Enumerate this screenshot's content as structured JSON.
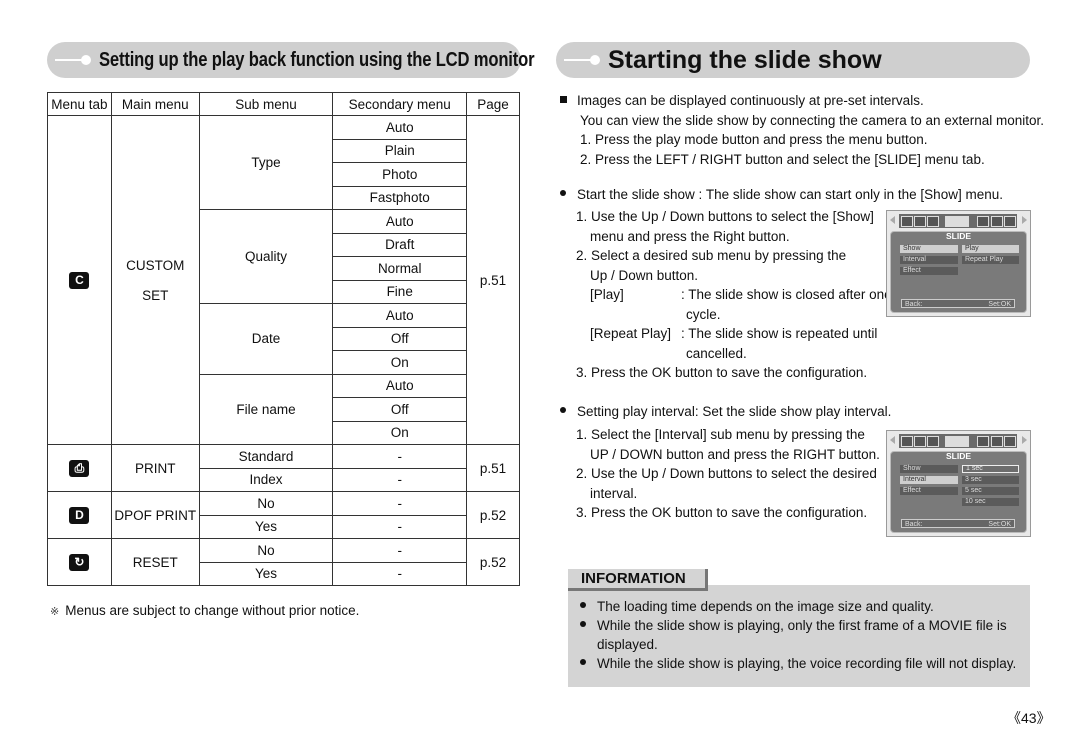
{
  "left": {
    "header": "Setting up the play back function using the LCD monitor",
    "table": {
      "columns": [
        "Menu tab",
        "Main menu",
        "Sub menu",
        "Secondary menu",
        "Page"
      ],
      "groups": [
        {
          "tab_icon": "custom-set-icon",
          "tab_glyph": "C",
          "main_menu": [
            "CUSTOM",
            "SET"
          ],
          "page": "p.51",
          "submenus": [
            {
              "name": "Type",
              "options": [
                "Auto",
                "Plain",
                "Photo",
                "Fastphoto"
              ]
            },
            {
              "name": "Quality",
              "options": [
                "Auto",
                "Draft",
                "Normal",
                "Fine"
              ]
            },
            {
              "name": "Date",
              "options": [
                "Auto",
                "Off",
                "On"
              ]
            },
            {
              "name": "File name",
              "options": [
                "Auto",
                "Off",
                "On"
              ]
            }
          ]
        },
        {
          "tab_icon": "print-icon",
          "tab_glyph": "⎙",
          "main_menu": [
            "PRINT"
          ],
          "page": "p.51",
          "submenus": [
            {
              "name": "Standard",
              "options": [
                "-"
              ]
            },
            {
              "name": "Index",
              "options": [
                "-"
              ]
            }
          ]
        },
        {
          "tab_icon": "dpof-print-icon",
          "tab_glyph": "D",
          "main_menu": [
            "DPOF PRINT"
          ],
          "page": "p.52",
          "submenus": [
            {
              "name": "No",
              "options": [
                "-"
              ]
            },
            {
              "name": "Yes",
              "options": [
                "-"
              ]
            }
          ]
        },
        {
          "tab_icon": "reset-icon",
          "tab_glyph": "↻",
          "main_menu": [
            "RESET"
          ],
          "page": "p.52",
          "submenus": [
            {
              "name": "No",
              "options": [
                "-"
              ]
            },
            {
              "name": "Yes",
              "options": [
                "-"
              ]
            }
          ]
        }
      ]
    },
    "note_mark": "※",
    "note": "Menus are subject to change without prior notice."
  },
  "right": {
    "header": "Starting the slide show",
    "intro": {
      "bullet": "Images can be displayed continuously at pre-set intervals.",
      "line2": "You can view the slide show by connecting the camera to an external monitor.",
      "step1": "1. Press the play mode button and press the menu button.",
      "step2": "2. Press the LEFT / RIGHT button and select the [SLIDE] menu tab."
    },
    "start": {
      "bullet": "Start the slide show : The slide show can start only in the [Show] menu.",
      "step1a": "1. Use the Up / Down buttons to select the [Show]",
      "step1b": "menu and press the Right button.",
      "step2a": "2. Select a desired sub menu by pressing the",
      "step2b": "Up / Down button.",
      "play_label": "[Play]",
      "play_desc_a": ": The slide show is closed after one",
      "play_desc_b": "cycle.",
      "repeat_label": "[Repeat Play]",
      "repeat_desc_a": ": The slide show is repeated until",
      "repeat_desc_b": "cancelled.",
      "step3": "3. Press the OK button to save the configuration."
    },
    "interval": {
      "bullet": "Setting play interval: Set the slide show play interval.",
      "step1a": "1. Select the [Interval] sub menu by pressing the",
      "step1b": "UP / DOWN button and press the RIGHT button.",
      "step2a": "2. Use the Up / Down buttons to select the desired",
      "step2b": "interval.",
      "step3": "3. Press the OK button to save the configuration."
    },
    "lcd1": {
      "title": "SLIDE",
      "menu": [
        "Show",
        "Interval",
        "Effect"
      ],
      "options": [
        "Play",
        "Repeat Play"
      ],
      "back": "Back:",
      "set": "Set:OK"
    },
    "lcd2": {
      "title": "SLIDE",
      "menu": [
        "Show",
        "Interval",
        "Effect"
      ],
      "options": [
        "1 sec",
        "3 sec",
        "5 sec",
        "10 sec"
      ],
      "back": "Back:",
      "set": "Set:OK"
    },
    "information": {
      "title": "INFORMATION",
      "items": [
        "The loading time depends on the image size and quality.",
        "While the slide show is playing, only the first frame of a MOVIE file is",
        "displayed.",
        "While the slide show is playing, the voice recording file will not display."
      ]
    }
  },
  "page_number": "《43》"
}
